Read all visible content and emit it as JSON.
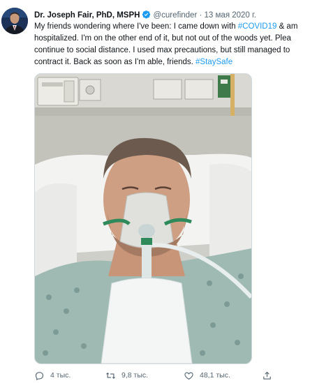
{
  "author": {
    "name": "Dr. Joseph Fair, PhD, MSPH",
    "handle": "@curefinder",
    "separator": "·",
    "date": "13 мая 2020 г."
  },
  "text": {
    "line1_pre": "My friends wondering where I've been: I came down with ",
    "line1_hashtag": "#COVID19",
    "line1_post": " & am",
    "line2": "hospitalized. I'm on the other end of it, but not out of the woods yet. Plea",
    "line3": "continue to social distance. I used max precautions, but still managed to",
    "line4_pre": "contract it. Back as soon as I'm able, friends. ",
    "line4_hashtag": "#StaySafe"
  },
  "actions": {
    "reply_count": "4 тыс.",
    "retweet_count": "9,8 тыс.",
    "like_count": "48,1 тыс."
  },
  "icons": {
    "verified": "verified-badge-icon",
    "reply": "reply-icon",
    "retweet": "retweet-icon",
    "like": "heart-icon",
    "share": "share-icon"
  },
  "colors": {
    "link": "#1d9bf0",
    "secondary_text": "#536471",
    "verified": "#1d9bf0"
  }
}
